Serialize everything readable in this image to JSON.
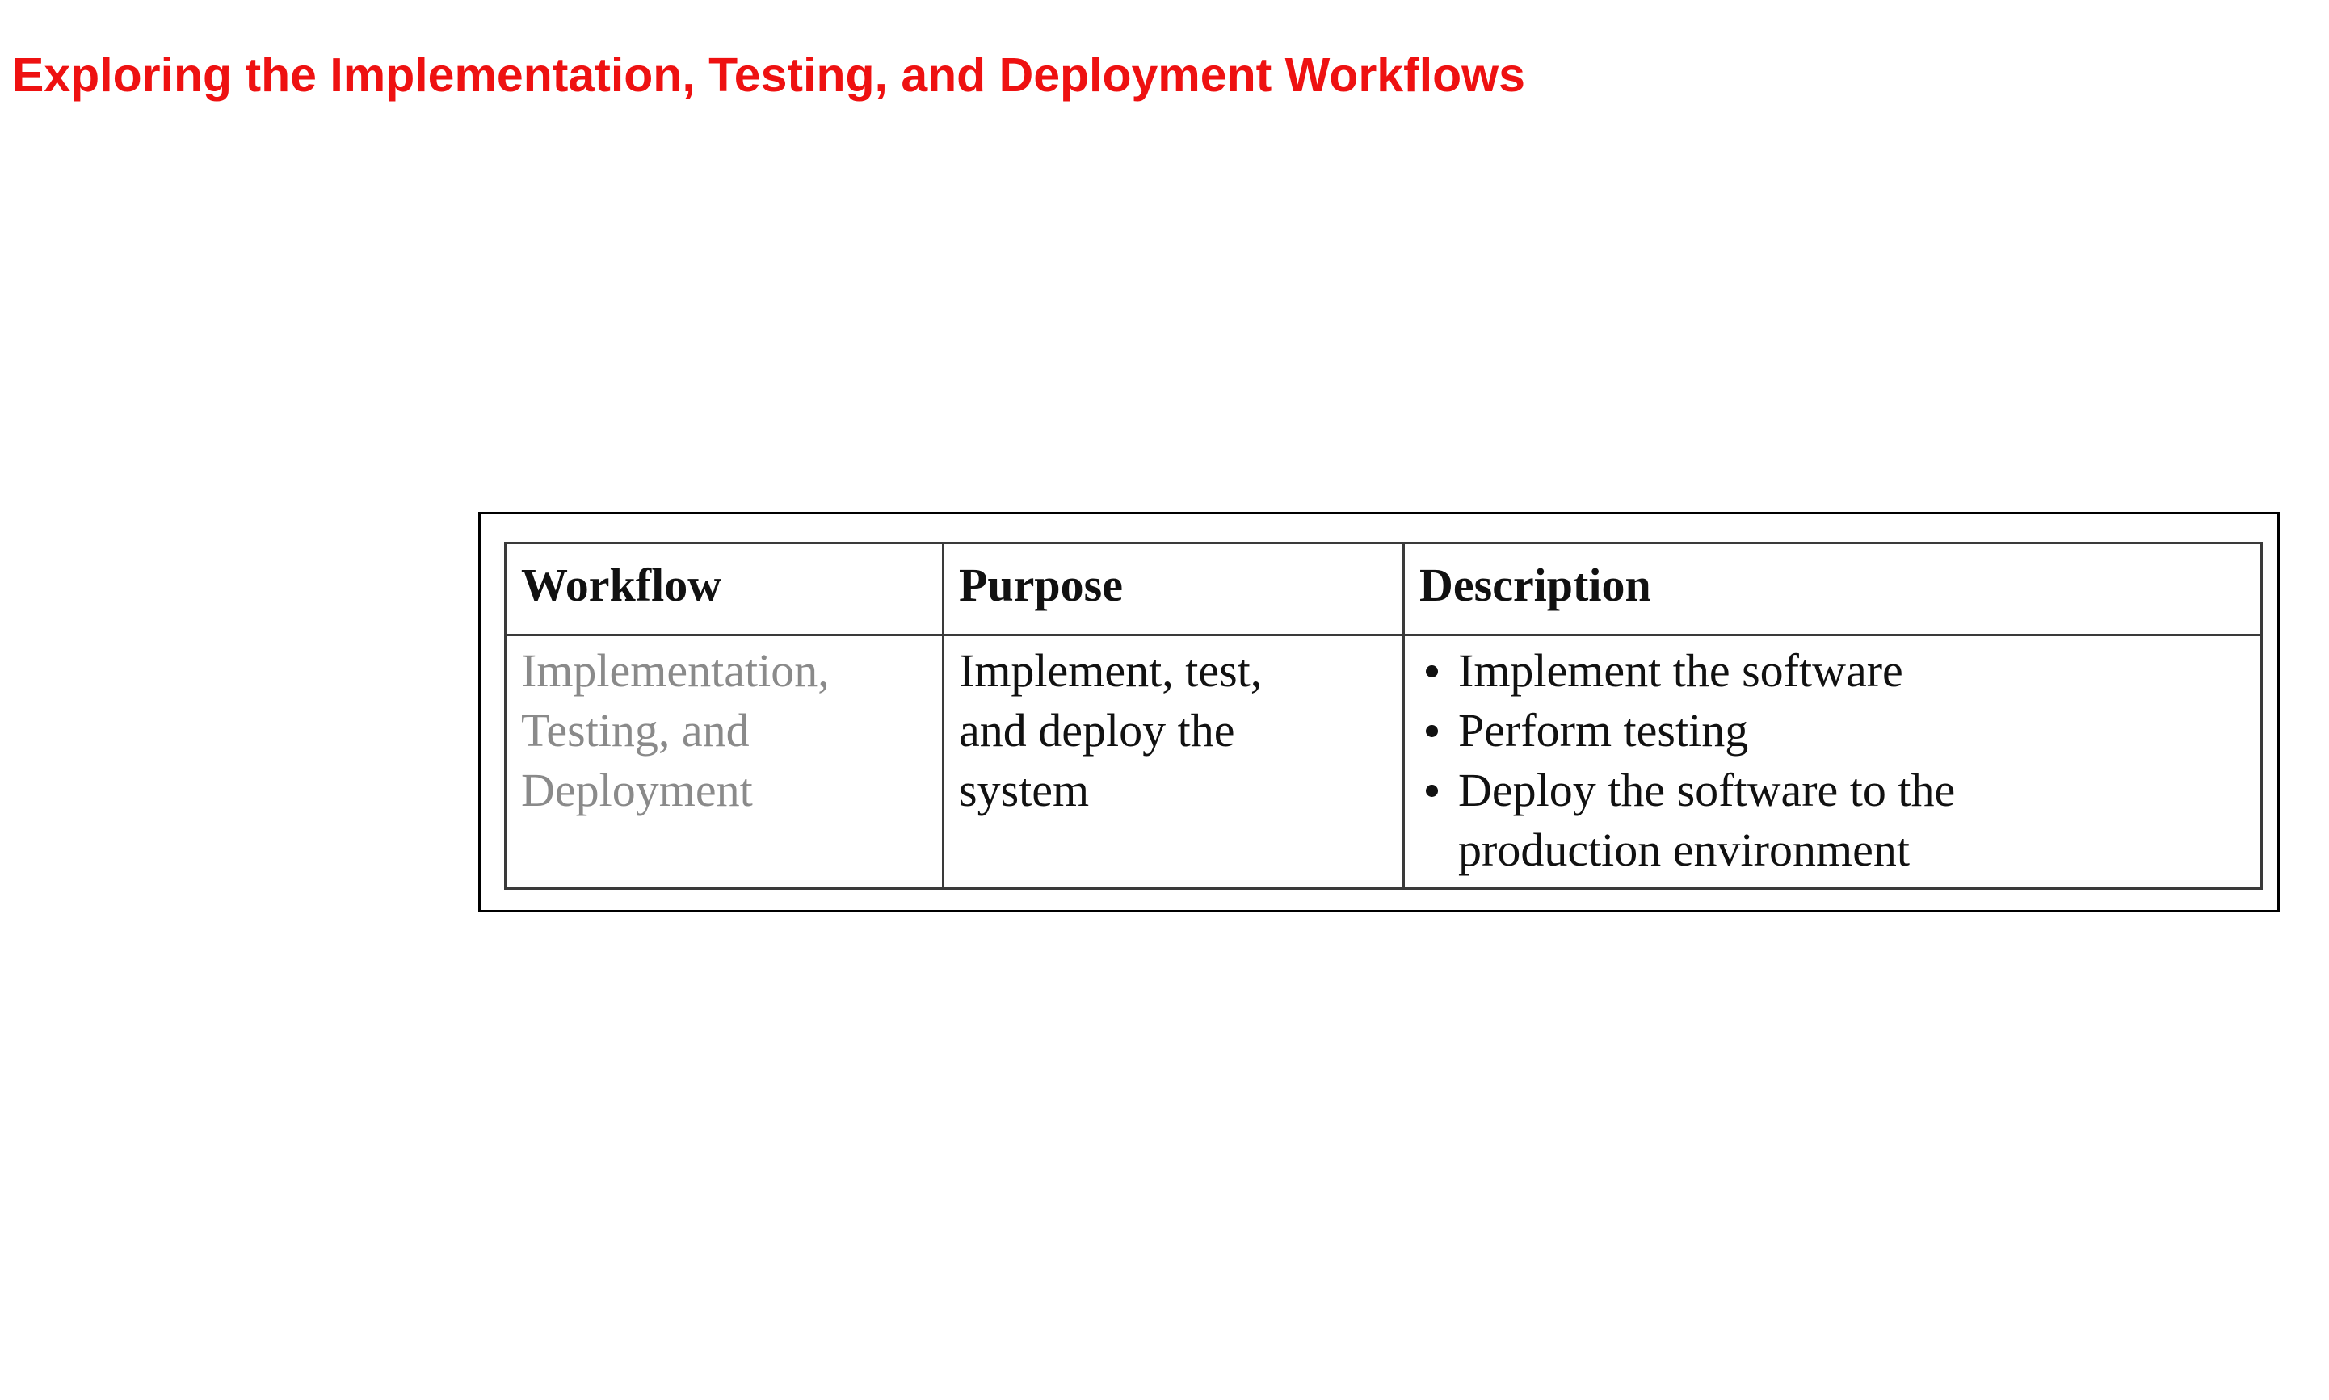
{
  "page": {
    "title": "Exploring the Implementation, Testing, and Deployment Workflows"
  },
  "table": {
    "headers": {
      "workflow": "Workflow",
      "purpose": "Purpose",
      "description": "Description"
    },
    "rows": [
      {
        "workflow": "Implementation,\nTesting, and\nDeployment",
        "purpose": "Implement, test,\nand deploy the\nsystem",
        "description": [
          "Implement the software",
          "Perform testing",
          "Deploy the software to the\nproduction environment"
        ]
      }
    ]
  },
  "colors": {
    "title": "#ee1111",
    "workflow_cell_text": "#8a8a8a",
    "body_text": "#111111"
  }
}
